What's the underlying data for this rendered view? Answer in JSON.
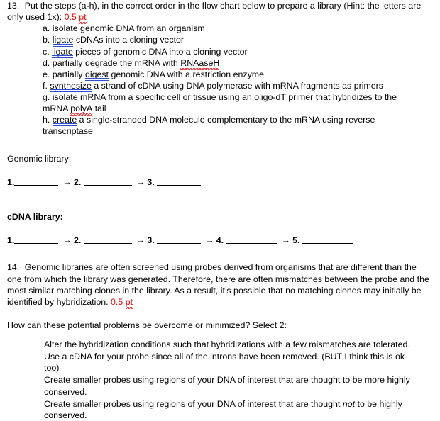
{
  "document": {
    "question13": {
      "number": "13.",
      "prompt_before": "Put the steps (a-h), in the correct order in the flow chart below to prepare a library (Hint: the letters are only used 1x):",
      "points_value": "0.5",
      "points_unit": "pt",
      "steps": [
        {
          "label": "a.",
          "pre": "isolate genomic DNA from an organism",
          "grammar_word": "",
          "post": ""
        },
        {
          "label": "b.",
          "pre": "",
          "grammar_word": "ligate",
          "post": " cDNAs into a cloning vector"
        },
        {
          "label": "c.",
          "pre": "",
          "grammar_word": "ligate",
          "post": " pieces of genomic DNA into a cloning vector"
        },
        {
          "label": "d.",
          "pre": "partially ",
          "grammar_word": "degrade",
          "post": " the mRNA with ",
          "spell_word": "RNAaseH",
          "tail": ""
        },
        {
          "label": "e.",
          "pre": "partially ",
          "grammar_word": "digest",
          "post": " genomic DNA with a restriction enzyme"
        },
        {
          "label": "f.",
          "pre": "",
          "grammar_word": "synthesize",
          "post": " a strand of cDNA using DNA polymerase with mRNA fragments as primers"
        },
        {
          "label": "g.",
          "pre": "isolate mRNA from a specific cell or tissue using an oligo-dT primer that hybridizes to the mRNA ",
          "grammar_word": "",
          "spell_word": "polyA",
          "tail": " tail"
        },
        {
          "label": "h.",
          "pre": "",
          "grammar_word": "create",
          "post": " a single-stranded DNA molecule complementary to the mRNA using reverse transcriptase"
        }
      ]
    },
    "genomic_library": {
      "heading": "Genomic library:",
      "steps": [
        "1.",
        "2.",
        "3."
      ],
      "arrow": "→"
    },
    "cdna_library": {
      "heading": "cDNA library:",
      "steps": [
        "1.",
        "2.",
        "3.",
        "4.",
        "5."
      ],
      "arrow": "→"
    },
    "question14": {
      "number": "14.",
      "body": "Genomic libraries are often screened using probes derived from organisms that are different than the one from which the library was generated. Therefore, there are often mismatches between the probe and the most similar matching clones in the library. As a result, it’s possible that no matching clones may initially be identified by hybridization.",
      "points_value": "0.5",
      "points_unit": "pt",
      "sub_prompt": "How can these potential problems be overcome or minimized? Select 2:",
      "options": [
        {
          "text": "Alter the hybridization conditions such that hybridizations with a few mismatches are tolerated.",
          "italic_word": "",
          "text_after": ""
        },
        {
          "text": "Use a cDNA for your probe since all of the introns have been removed. (BUT I think this is ok too)",
          "italic_word": "",
          "text_after": ""
        },
        {
          "text": "Create smaller probes using regions of your DNA of interest that are thought to be more highly conserved.",
          "italic_word": "",
          "text_after": ""
        },
        {
          "text": "Create smaller probes using regions of your DNA of interest that are thought ",
          "italic_word": "not",
          "text_after": " to be highly conserved."
        }
      ]
    },
    "colors": {
      "points_red": "#ff0000",
      "grammar_underline_blue": "#2a4fd6",
      "text_black": "#000000",
      "background": "#ffffff"
    }
  }
}
